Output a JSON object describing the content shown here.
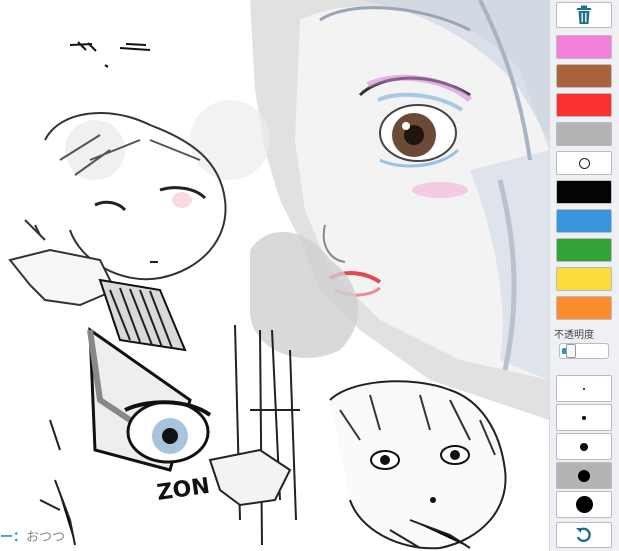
{
  "canvas": {
    "author_prefix": "ー：",
    "author_name": "おつつ"
  },
  "palette": {
    "trash_icon": "trash-icon",
    "colors": [
      {
        "name": "pink",
        "hex": "#f27fd9"
      },
      {
        "name": "brown",
        "hex": "#a8633c"
      },
      {
        "name": "red",
        "hex": "#fa3131"
      },
      {
        "name": "gray",
        "hex": "#b3b3b3"
      },
      {
        "name": "eraser",
        "hex": "#ffffff"
      },
      {
        "name": "black",
        "hex": "#050505"
      },
      {
        "name": "blue",
        "hex": "#3a96dc"
      },
      {
        "name": "green",
        "hex": "#32a339"
      },
      {
        "name": "yellow",
        "hex": "#fbdc3c"
      },
      {
        "name": "orange",
        "hex": "#fb8d2c"
      }
    ],
    "opacity_label": "不透明度",
    "opacity_value": 0.2,
    "brush_sizes": [
      "xs",
      "s",
      "m",
      "l",
      "xl"
    ],
    "selected_size": "l",
    "undo_icon": "undo-icon"
  },
  "colors": {
    "panel_bg": "#eef0f3",
    "accent": "#2a8fd0",
    "selected_bg": "#b4b4b4"
  }
}
